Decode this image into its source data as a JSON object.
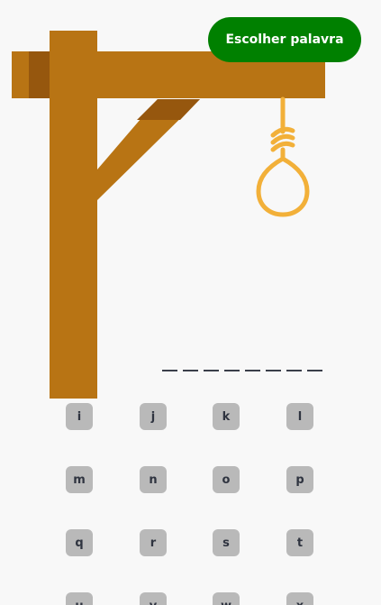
{
  "actions": {
    "choose_word_label": "Escolher palavra"
  },
  "word": {
    "slots": [
      "",
      "",
      "",
      "",
      "",
      "",
      "",
      ""
    ]
  },
  "keyboard": {
    "keys": [
      "i",
      "j",
      "k",
      "l",
      "m",
      "n",
      "o",
      "p",
      "q",
      "r",
      "s",
      "t",
      "u",
      "v",
      "w",
      "x"
    ]
  },
  "colors": {
    "wood": "#b87414",
    "wood_shadow": "#96570e",
    "rope": "#f2b039",
    "button": "#008000",
    "key_bg": "#b9b9b9",
    "key_text": "#2f3440",
    "background": "#f8f8f8"
  }
}
